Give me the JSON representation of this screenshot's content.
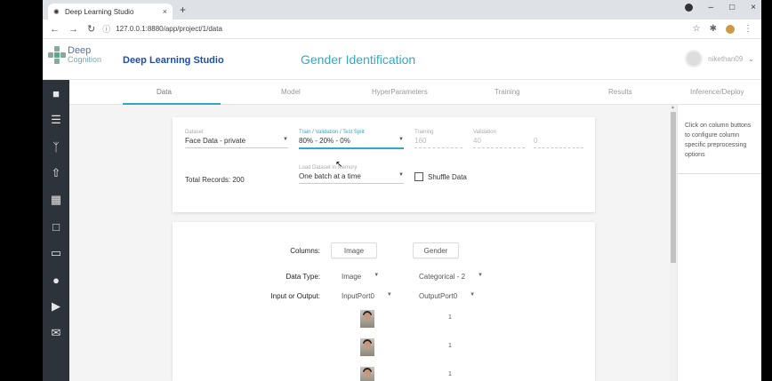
{
  "browser": {
    "tab_title": "Deep Learning Studio",
    "url": "127.0.0.1:8880/app/project/1/data"
  },
  "header": {
    "brand_line1": "Deep",
    "brand_line2": "Cognition",
    "app_name": "Deep Learning Studio",
    "project_title": "Gender Identification",
    "username": "nikethan09"
  },
  "tabs": [
    {
      "label": "Data"
    },
    {
      "label": "Model"
    },
    {
      "label": "HyperParameters"
    },
    {
      "label": "Training"
    },
    {
      "label": "Results"
    },
    {
      "label": "Inference/Deploy"
    }
  ],
  "dataset_card": {
    "dataset_label": "Dataset",
    "dataset_value": "Face Data - private",
    "split_label": "Train / Validation / Test Split",
    "split_value": "80% - 20% - 0%",
    "training_label": "Training",
    "training_value": "160",
    "validation_label": "Validation",
    "validation_value": "40",
    "test_value": "0",
    "total_records": "Total Records: 200",
    "load_label": "Load Dataset in Memory",
    "load_value": "One batch at a time",
    "shuffle_label": "Shuffle Data"
  },
  "columns_card": {
    "columns_label": "Columns:",
    "data_type_label": "Data Type:",
    "io_label": "Input or Output:",
    "columns": [
      {
        "name": "Image",
        "data_type": "Image",
        "io": "InputPort0"
      },
      {
        "name": "Gender",
        "data_type": "Categorical - 2",
        "io": "OutputPort0"
      }
    ],
    "rows": [
      {
        "gender": "1"
      },
      {
        "gender": "1"
      },
      {
        "gender": "1"
      }
    ]
  },
  "right_panel": {
    "hint": "Click on column buttons to configure column specific preprocessing options"
  }
}
